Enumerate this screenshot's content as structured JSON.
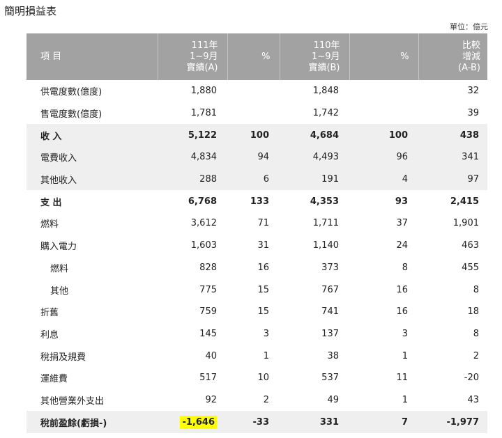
{
  "title": "簡明損益表",
  "unit": "單位：億元",
  "header": {
    "item": "項 目",
    "col_a": [
      "111年",
      "1~9月",
      "實績(A)"
    ],
    "pct_a": "%",
    "col_b": [
      "110年",
      "1~9月",
      "實績(B)"
    ],
    "pct_b": "%",
    "diff": [
      "比較",
      "增減",
      "(A-B)"
    ]
  },
  "rows": [
    {
      "label": "供電度數(億度)",
      "a": "1,880",
      "pa": "",
      "b": "1,848",
      "pb": "",
      "d": "32"
    },
    {
      "label": "售電度數(億度)",
      "a": "1,781",
      "pa": "",
      "b": "1,742",
      "pb": "",
      "d": "39"
    },
    {
      "label": "收 入",
      "a": "5,122",
      "pa": "100",
      "b": "4,684",
      "pb": "100",
      "d": "438"
    },
    {
      "label": "電費收入",
      "a": "4,834",
      "pa": "94",
      "b": "4,493",
      "pb": "96",
      "d": "341"
    },
    {
      "label": "其他收入",
      "a": "288",
      "pa": "6",
      "b": "191",
      "pb": "4",
      "d": "97"
    },
    {
      "label": "支 出",
      "a": "6,768",
      "pa": "133",
      "b": "4,353",
      "pb": "93",
      "d": "2,415"
    },
    {
      "label": "燃料",
      "a": "3,612",
      "pa": "71",
      "b": "1,711",
      "pb": "37",
      "d": "1,901"
    },
    {
      "label": "購入電力",
      "a": "1,603",
      "pa": "31",
      "b": "1,140",
      "pb": "24",
      "d": "463"
    },
    {
      "label": "燃料",
      "a": "828",
      "pa": "16",
      "b": "373",
      "pb": "8",
      "d": "455"
    },
    {
      "label": "其他",
      "a": "775",
      "pa": "15",
      "b": "767",
      "pb": "16",
      "d": "8"
    },
    {
      "label": "折舊",
      "a": "759",
      "pa": "15",
      "b": "741",
      "pb": "16",
      "d": "18"
    },
    {
      "label": "利息",
      "a": "145",
      "pa": "3",
      "b": "137",
      "pb": "3",
      "d": "8"
    },
    {
      "label": "稅捐及規費",
      "a": "40",
      "pa": "1",
      "b": "38",
      "pb": "1",
      "d": "2"
    },
    {
      "label": "運維費",
      "a": "517",
      "pa": "10",
      "b": "537",
      "pb": "11",
      "d": "-20"
    },
    {
      "label": "其他營業外支出",
      "a": "92",
      "pa": "2",
      "b": "49",
      "pb": "1",
      "d": "43"
    },
    {
      "label": "稅前盈餘(虧損-)",
      "a": "-1,646",
      "pa": "-33",
      "b": "331",
      "pb": "7",
      "d": "-1,977"
    }
  ]
}
